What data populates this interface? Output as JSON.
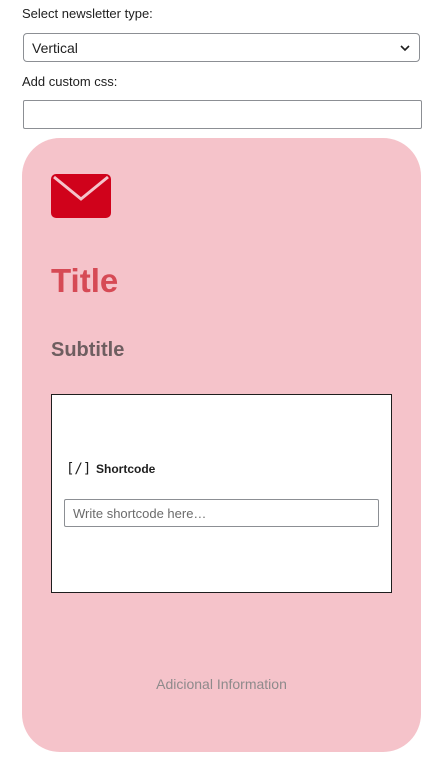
{
  "settings": {
    "newsletter_type_label": "Select newsletter type:",
    "newsletter_type_value": "Vertical",
    "custom_css_label": "Add custom css:",
    "custom_css_value": ""
  },
  "card": {
    "background_color": "#f5c3ca",
    "icon": "envelope-icon",
    "icon_color": "#d0021b",
    "title": "Title",
    "title_color": "#d64a55",
    "subtitle": "Subtitle",
    "shortcode": {
      "icon_text": "[/]",
      "label": "Shortcode",
      "placeholder": "Write shortcode here…"
    },
    "additional_info": "Adicional Information"
  }
}
